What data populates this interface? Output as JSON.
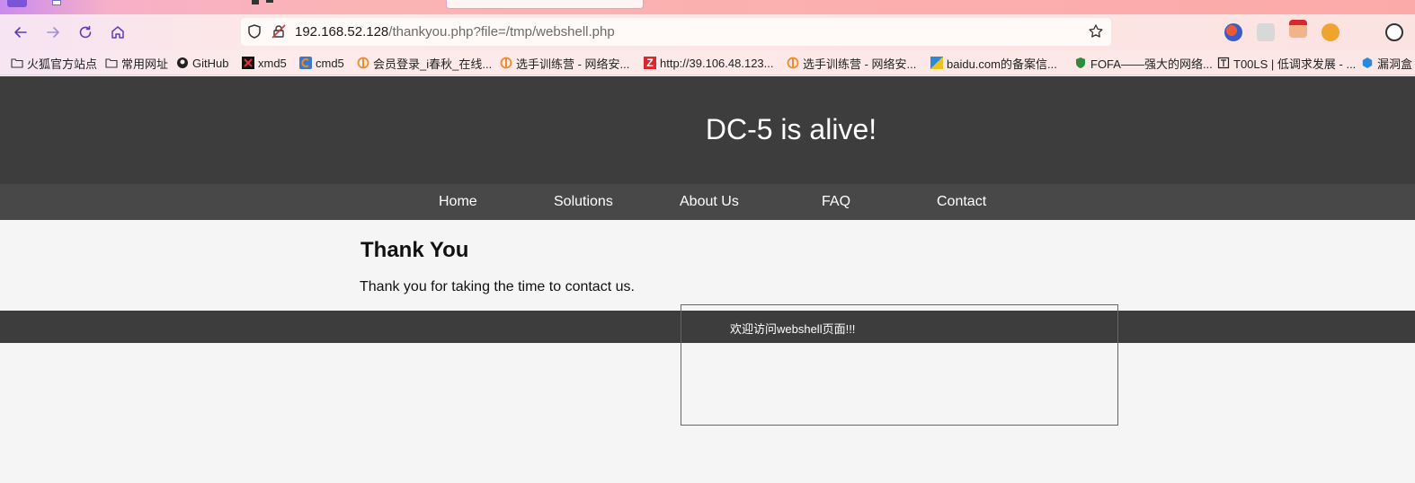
{
  "browser": {
    "address_bar": {
      "host": "192.168.52.128",
      "path": "/thankyou.php?file=/tmp/webshell.php"
    },
    "bookmarks": [
      {
        "label": "火狐官方站点",
        "icon": "folder-icon"
      },
      {
        "label": "常用网址",
        "icon": "folder-icon"
      },
      {
        "label": "GitHub",
        "icon": "github-icon"
      },
      {
        "label": "xmd5",
        "icon": "xmd5-icon"
      },
      {
        "label": "cmd5",
        "icon": "cmd5-icon"
      },
      {
        "label": "会员登录_i春秋_在线...",
        "icon": "ichunqiu-icon"
      },
      {
        "label": "选手训练营 - 网络安...",
        "icon": "ichunqiu-icon"
      },
      {
        "label": "http://39.106.48.123...",
        "icon": "zentao-icon"
      },
      {
        "label": "选手训练营 - 网络安...",
        "icon": "ichunqiu-icon"
      },
      {
        "label": "baidu.com的备案信...",
        "icon": "beian-icon"
      },
      {
        "label": "FOFA——强大的网络...",
        "icon": "fofa-icon"
      },
      {
        "label": "T00LS | 低调求发展 - ...",
        "icon": "t00ls-icon"
      },
      {
        "label": "漏洞盒",
        "icon": "vulbox-icon"
      }
    ]
  },
  "page": {
    "site_title": "DC-5 is alive!",
    "nav": [
      "Home",
      "Solutions",
      "About Us",
      "FAQ",
      "Contact"
    ],
    "heading": "Thank You",
    "message": "Thank you for taking the time to contact us.",
    "footer_message": "欢迎访问webshell页面!!!"
  },
  "colors": {
    "header_bg": "#3d3d3d",
    "nav_bg": "#484848",
    "highlight_border": "#e0313a"
  }
}
